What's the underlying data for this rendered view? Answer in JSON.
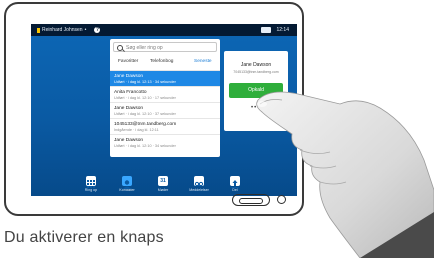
{
  "status": {
    "user_name": "Reinhard Johnsen",
    "user_suffix": "•",
    "help_glyph": "?",
    "time": "12:14"
  },
  "search": {
    "placeholder": "Søg eller ring op"
  },
  "tabs": [
    {
      "label": "Favoritter"
    },
    {
      "label": "Telefonbog"
    },
    {
      "label": "Seneste",
      "active": true
    }
  ],
  "contacts": [
    {
      "name": "Jane Dawson",
      "detail": "Udført · i dag kl. 12:13 · 34 sekunder",
      "selected": true
    },
    {
      "name": "Anita Francotto",
      "detail": "Udført · i dag kl. 12:10 · 17 sekunder"
    },
    {
      "name": "Jane Dawson",
      "detail": "Udført · i dag kl. 12:10 · 37 sekunder"
    },
    {
      "name": "1045133@tnm.tandberg.com",
      "detail": "Indgående · i dag kl. 12:11"
    },
    {
      "name": "Jane Dawson",
      "detail": "Udført · i dag kl. 12:10 · 34 sekunder"
    }
  ],
  "detail_card": {
    "name": "Jane Dawson",
    "uri": "7045133@tnm.tandberg.com",
    "call_label": "Opkald",
    "more_glyph": "•••"
  },
  "bottom_bar": [
    {
      "label": "Ring op",
      "icon": "keypad-icon"
    },
    {
      "label": "Kontakter",
      "icon": "contacts-icon",
      "active": true
    },
    {
      "label": "Møder",
      "icon": "calendar-icon",
      "glyph": "31"
    },
    {
      "label": "Meddelelser",
      "icon": "voicemail-icon"
    },
    {
      "label": "Del",
      "icon": "share-icon"
    }
  ],
  "caption": "Du aktiverer en knaps"
}
